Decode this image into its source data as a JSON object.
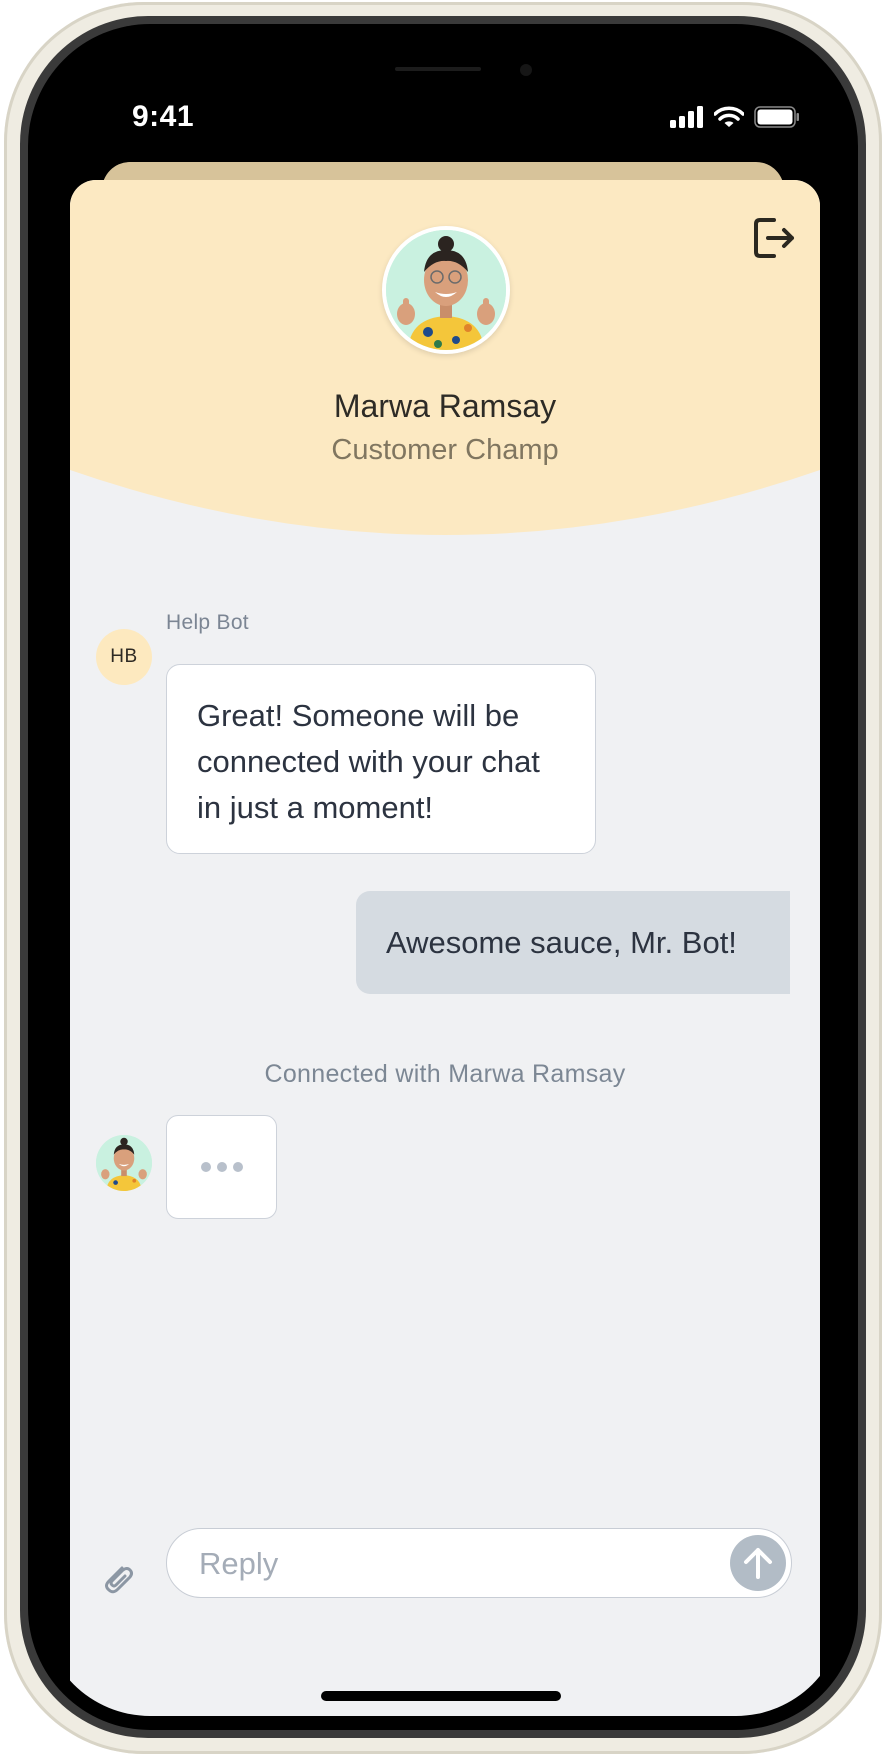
{
  "status_bar": {
    "time": "9:41"
  },
  "agent": {
    "name": "Marwa Ramsay",
    "role": "Customer Champ"
  },
  "messages": [
    {
      "sender": "Help Bot",
      "initials": "HB",
      "text": "Great! Someone will be connected with your chat in just a moment!"
    },
    {
      "sender": "user",
      "text": "Awesome sauce, Mr. Bot!"
    }
  ],
  "system_note": "Connected with Marwa Ramsay",
  "composer": {
    "placeholder": "Reply"
  },
  "icons": {
    "logout": "logout-icon",
    "attach": "paperclip-icon",
    "send": "arrow-up-icon",
    "signal": "signal-icon",
    "wifi": "wifi-icon",
    "battery": "battery-icon"
  },
  "colors": {
    "header": "#fce9c2",
    "background": "#f0f1f3",
    "user_bubble": "#d5dbe1",
    "send_button": "#b2bcc6",
    "avatar_bg": "#c9f1e0"
  }
}
